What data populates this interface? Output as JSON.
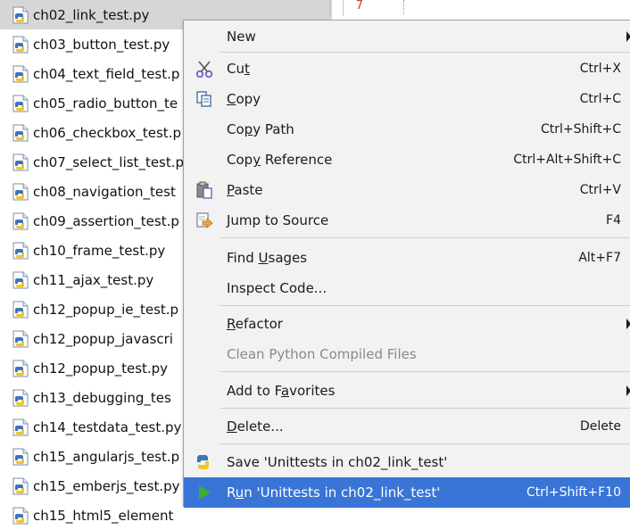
{
  "tree": {
    "files": [
      "ch02_link_test.py",
      "ch03_button_test.py",
      "ch04_text_field_test.p",
      "ch05_radio_button_te",
      "ch06_checkbox_test.p",
      "ch07_select_list_test.p",
      "ch08_navigation_test",
      "ch09_assertion_test.p",
      "ch10_frame_test.py",
      "ch11_ajax_test.py",
      "ch12_popup_ie_test.p",
      "ch12_popup_javascri",
      "ch12_popup_test.py",
      "ch13_debugging_tes",
      "ch14_testdata_test.py",
      "ch15_angularjs_test.p",
      "ch15_emberjs_test.py",
      "ch15_html5_element"
    ],
    "selected_index": 0
  },
  "editor": {
    "gutter_line_number": "7"
  },
  "menu": {
    "new": {
      "label": "New"
    },
    "cut": {
      "pre": "Cu",
      "ul": "t",
      "post": "",
      "shortcut": "Ctrl+X"
    },
    "copy": {
      "pre": "",
      "ul": "C",
      "post": "opy",
      "shortcut": "Ctrl+C"
    },
    "copy_path": {
      "pre": "Co",
      "ul": "p",
      "post": "y Path",
      "shortcut": "Ctrl+Shift+C"
    },
    "copy_reference": {
      "pre": "Cop",
      "ul": "y",
      "post": " Reference",
      "shortcut": "Ctrl+Alt+Shift+C"
    },
    "paste": {
      "pre": "",
      "ul": "P",
      "post": "aste",
      "shortcut": "Ctrl+V"
    },
    "jump_to_source": {
      "label": "Jump to Source",
      "shortcut": "F4"
    },
    "find_usages": {
      "pre": "Find ",
      "ul": "U",
      "post": "sages",
      "shortcut": "Alt+F7"
    },
    "inspect_code": {
      "label": "Inspect Code..."
    },
    "refactor": {
      "pre": "",
      "ul": "R",
      "post": "efactor"
    },
    "clean_python": {
      "label": "Clean Python Compiled Files"
    },
    "add_to_favorites": {
      "pre": "Add to F",
      "ul": "a",
      "post": "vorites"
    },
    "delete": {
      "pre": "",
      "ul": "D",
      "post": "elete...",
      "shortcut": "Delete"
    },
    "save_unittests": {
      "label": "Save 'Unittests in ch02_link_test'"
    },
    "run_unittests": {
      "pre": "R",
      "ul": "u",
      "post": "n 'Unittests in ch02_link_test'",
      "shortcut": "Ctrl+Shift+F10"
    }
  },
  "colors": {
    "menu_background": "#f2f2f2",
    "highlight": "#3875d7",
    "selected_row": "#d6d6d6",
    "run_icon_green": "#3fae2a"
  },
  "icons": {
    "file": "python-file-icon",
    "cut": "scissors-icon",
    "copy": "copy-icon",
    "paste": "paste-icon",
    "jump": "jump-to-source-icon",
    "save": "python-save-icon",
    "run": "run-triangle-icon"
  }
}
